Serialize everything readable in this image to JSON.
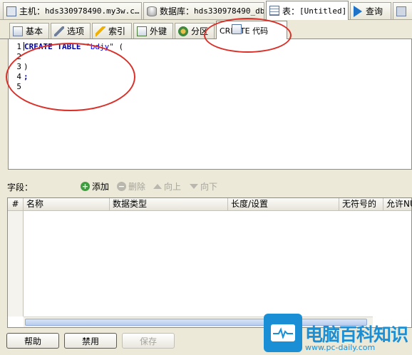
{
  "top_tabs": [
    {
      "label": "主机：",
      "value": "hds330978490.my3w.c…",
      "icon": "host-icon"
    },
    {
      "label": "数据库：",
      "value": "hds330978490_db",
      "icon": "database-icon"
    },
    {
      "label": "表：",
      "value": "[Untitled]",
      "icon": "table-icon"
    },
    {
      "label": "查询",
      "value": "",
      "icon": "query-play-icon"
    }
  ],
  "sub_tabs": [
    {
      "label": "基本",
      "icon": "basic-icon"
    },
    {
      "label": "选项",
      "icon": "wrench-icon"
    },
    {
      "label": "索引",
      "icon": "lightning-icon"
    },
    {
      "label": "外键",
      "icon": "foreign-key-icon"
    },
    {
      "label": "分区",
      "icon": "partition-icon"
    },
    {
      "label": "CREATE 代码",
      "icon": "code-icon"
    }
  ],
  "editor": {
    "line_numbers": [
      "1",
      "2",
      "3",
      "4",
      "5"
    ],
    "create_kw": "CREATE",
    "table_kw": "TABLE",
    "table_name": "\"bdjy\"",
    "open_paren": "(",
    "line3": ")",
    "line4": ";"
  },
  "fields_toolbar": {
    "label": "字段：",
    "add": "添加",
    "delete": "删除",
    "up": "向上",
    "down": "向下"
  },
  "grid": {
    "columns": [
      "#",
      "名称",
      "数据类型",
      "长度/设置",
      "无符号的",
      "允许NU"
    ]
  },
  "buttons": {
    "help": "帮助",
    "disable": "禁用",
    "save": "保存"
  },
  "watermark": {
    "title": "电脑百科知识",
    "url": "www.pc-daily.com"
  },
  "colors": {
    "annotation": "#d9312a",
    "watermark": "#1a8fd6",
    "keyword": "#0000a0"
  }
}
